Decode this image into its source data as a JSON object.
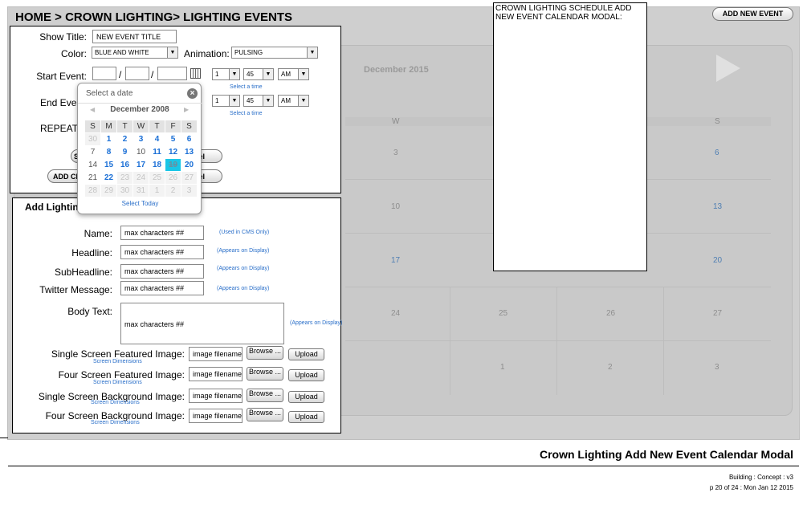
{
  "breadcrumb": "HOME > CROWN LIGHTING> LIGHTING EVENTS",
  "add_new_event_button": "ADD NEW EVENT",
  "background_calendar": {
    "month": "December 2015",
    "day_w": "W",
    "day_s": "S",
    "dates": [
      "3",
      "6",
      "10",
      "13",
      "17",
      "20",
      "24",
      "25",
      "26",
      "27",
      "1",
      "2",
      "3"
    ]
  },
  "event_form": {
    "show_title_label": "Show Title:",
    "show_title_value": "NEW EVENT TITLE",
    "color_label": "Color:",
    "color_value": "BLUE AND WHITE",
    "animation_label": "Animation:",
    "animation_value": "PULSING",
    "start_event_label": "Start Event:",
    "end_event_label": "End Even",
    "repeats_label": "REPEATS",
    "date_sep": "/",
    "start_hour": "1",
    "start_minute": "45",
    "start_ampm": "AM",
    "end_hour": "1",
    "end_minute": "45",
    "end_ampm": "AM",
    "select_time_link": "Select a time",
    "save_button": "S",
    "add_button": "ADD CR",
    "cancel_label_1": "el",
    "cancel_label_2": "el"
  },
  "datepicker": {
    "title": "Select a date",
    "month": "December 2008",
    "prev": "◀",
    "next": "▶",
    "day_headers": [
      "S",
      "M",
      "T",
      "W",
      "T",
      "F",
      "S"
    ],
    "weeks": [
      [
        "30",
        "1",
        "2",
        "3",
        "4",
        "5",
        "6"
      ],
      [
        "7",
        "8",
        "9",
        "10",
        "11",
        "12",
        "13"
      ],
      [
        "14",
        "15",
        "16",
        "17",
        "18",
        "19",
        "20"
      ],
      [
        "21",
        "22",
        "23",
        "24",
        "25",
        "26",
        "27"
      ],
      [
        "28",
        "29",
        "30",
        "31",
        "1",
        "2",
        "3"
      ]
    ],
    "select_today": "Select Today",
    "highlight_color": "#19c6e6"
  },
  "lighting_form": {
    "heading": "Add Lighting",
    "name_label": "Name:",
    "headline_label": "Headline:",
    "subheadline_label": "SubHeadline:",
    "twitter_label": "Twitter Message:",
    "body_label": "Body Text:",
    "placeholder": "max characters ##",
    "used_in_cms": "(Used in CMS Only)",
    "appears_on_display": "(Appears on Display)",
    "single_featured_label": "Single Screen Featured Image:",
    "four_featured_label": "Four Screen Featured Image:",
    "single_background_label": "Single Screen Background Image:",
    "four_background_label": "Four Screen Background Image:",
    "image_filename": "image filename",
    "browse_label": "Browse ...",
    "upload_label": "Upload",
    "screen_dimensions": "Screen Dimensions"
  },
  "note": "CROWN LIGHTING SCHEDULE ADD NEW EVENT CALENDAR MODAL:",
  "footer": {
    "title": "Crown Lighting Add New Event Calendar Modal",
    "meta1": "Building : Concept : v3",
    "meta2": "p 20 of 24 : Mon Jan 12 2015"
  },
  "colors": {
    "link_blue": "#2a6fc9",
    "date_blue": "#1a6fd6",
    "grey_bg": "#cfcfcf"
  },
  "icons": [
    "calendar-icon",
    "close-circle-icon",
    "chevron-left-icon",
    "chevron-right-icon",
    "dropdown-arrow-icon"
  ]
}
